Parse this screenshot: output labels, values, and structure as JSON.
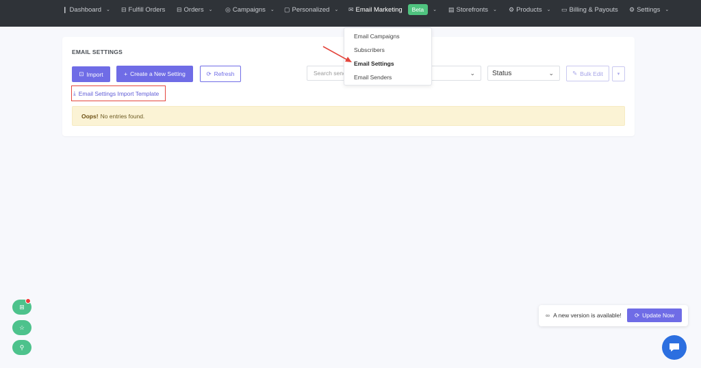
{
  "nav": {
    "items": [
      {
        "icon": "chart-icon",
        "glyph": "❙",
        "label": "Dashboard",
        "chevron": true
      },
      {
        "icon": "cart-icon",
        "glyph": "⊟",
        "label": "Fulfill Orders",
        "chevron": false
      },
      {
        "icon": "cart-icon",
        "glyph": "⊟",
        "label": "Orders",
        "chevron": true
      },
      {
        "icon": "target-icon",
        "glyph": "◎",
        "label": "Campaigns",
        "chevron": true
      },
      {
        "icon": "personalized-icon",
        "glyph": "▢",
        "label": "Personalized",
        "chevron": true
      },
      {
        "icon": "mail-icon",
        "glyph": "✉",
        "label": "Email Marketing",
        "badge": "Beta",
        "chevron": true
      },
      {
        "icon": "store-icon",
        "glyph": "▤",
        "label": "Storefronts",
        "chevron": true
      },
      {
        "icon": "products-icon",
        "glyph": "⚙",
        "label": "Products",
        "chevron": true
      },
      {
        "icon": "card-icon",
        "glyph": "▭",
        "label": "Billing & Payouts",
        "chevron": false
      },
      {
        "icon": "gear-icon",
        "glyph": "⚙",
        "label": "Settings",
        "chevron": true
      }
    ]
  },
  "dropdown": {
    "items": [
      {
        "label": "Email Campaigns",
        "active": false
      },
      {
        "label": "Subscribers",
        "active": false
      },
      {
        "label": "Email Settings",
        "active": true
      },
      {
        "label": "Email Senders",
        "active": false
      }
    ]
  },
  "card": {
    "title": "EMAIL SETTINGS",
    "import_label": "Import",
    "create_label": "Create a New Setting",
    "refresh_label": "Refresh",
    "search_placeholder": "Search send",
    "status_label": "Status",
    "bulk_edit_label": "Bulk Edit",
    "template_link": "Email Settings Import Template",
    "alert_strong": "Oops!",
    "alert_text": "No entries found."
  },
  "toast": {
    "message": "A new version is available!",
    "button": "Update Now"
  },
  "colors": {
    "primary": "#6f6ce6",
    "nav_bg": "#2f3338",
    "beta": "#4fc37f",
    "alert_bg": "#fbf3d5",
    "highlight": "#e4453c",
    "fab": "#4dc28c",
    "chat": "#2c6fe0"
  }
}
